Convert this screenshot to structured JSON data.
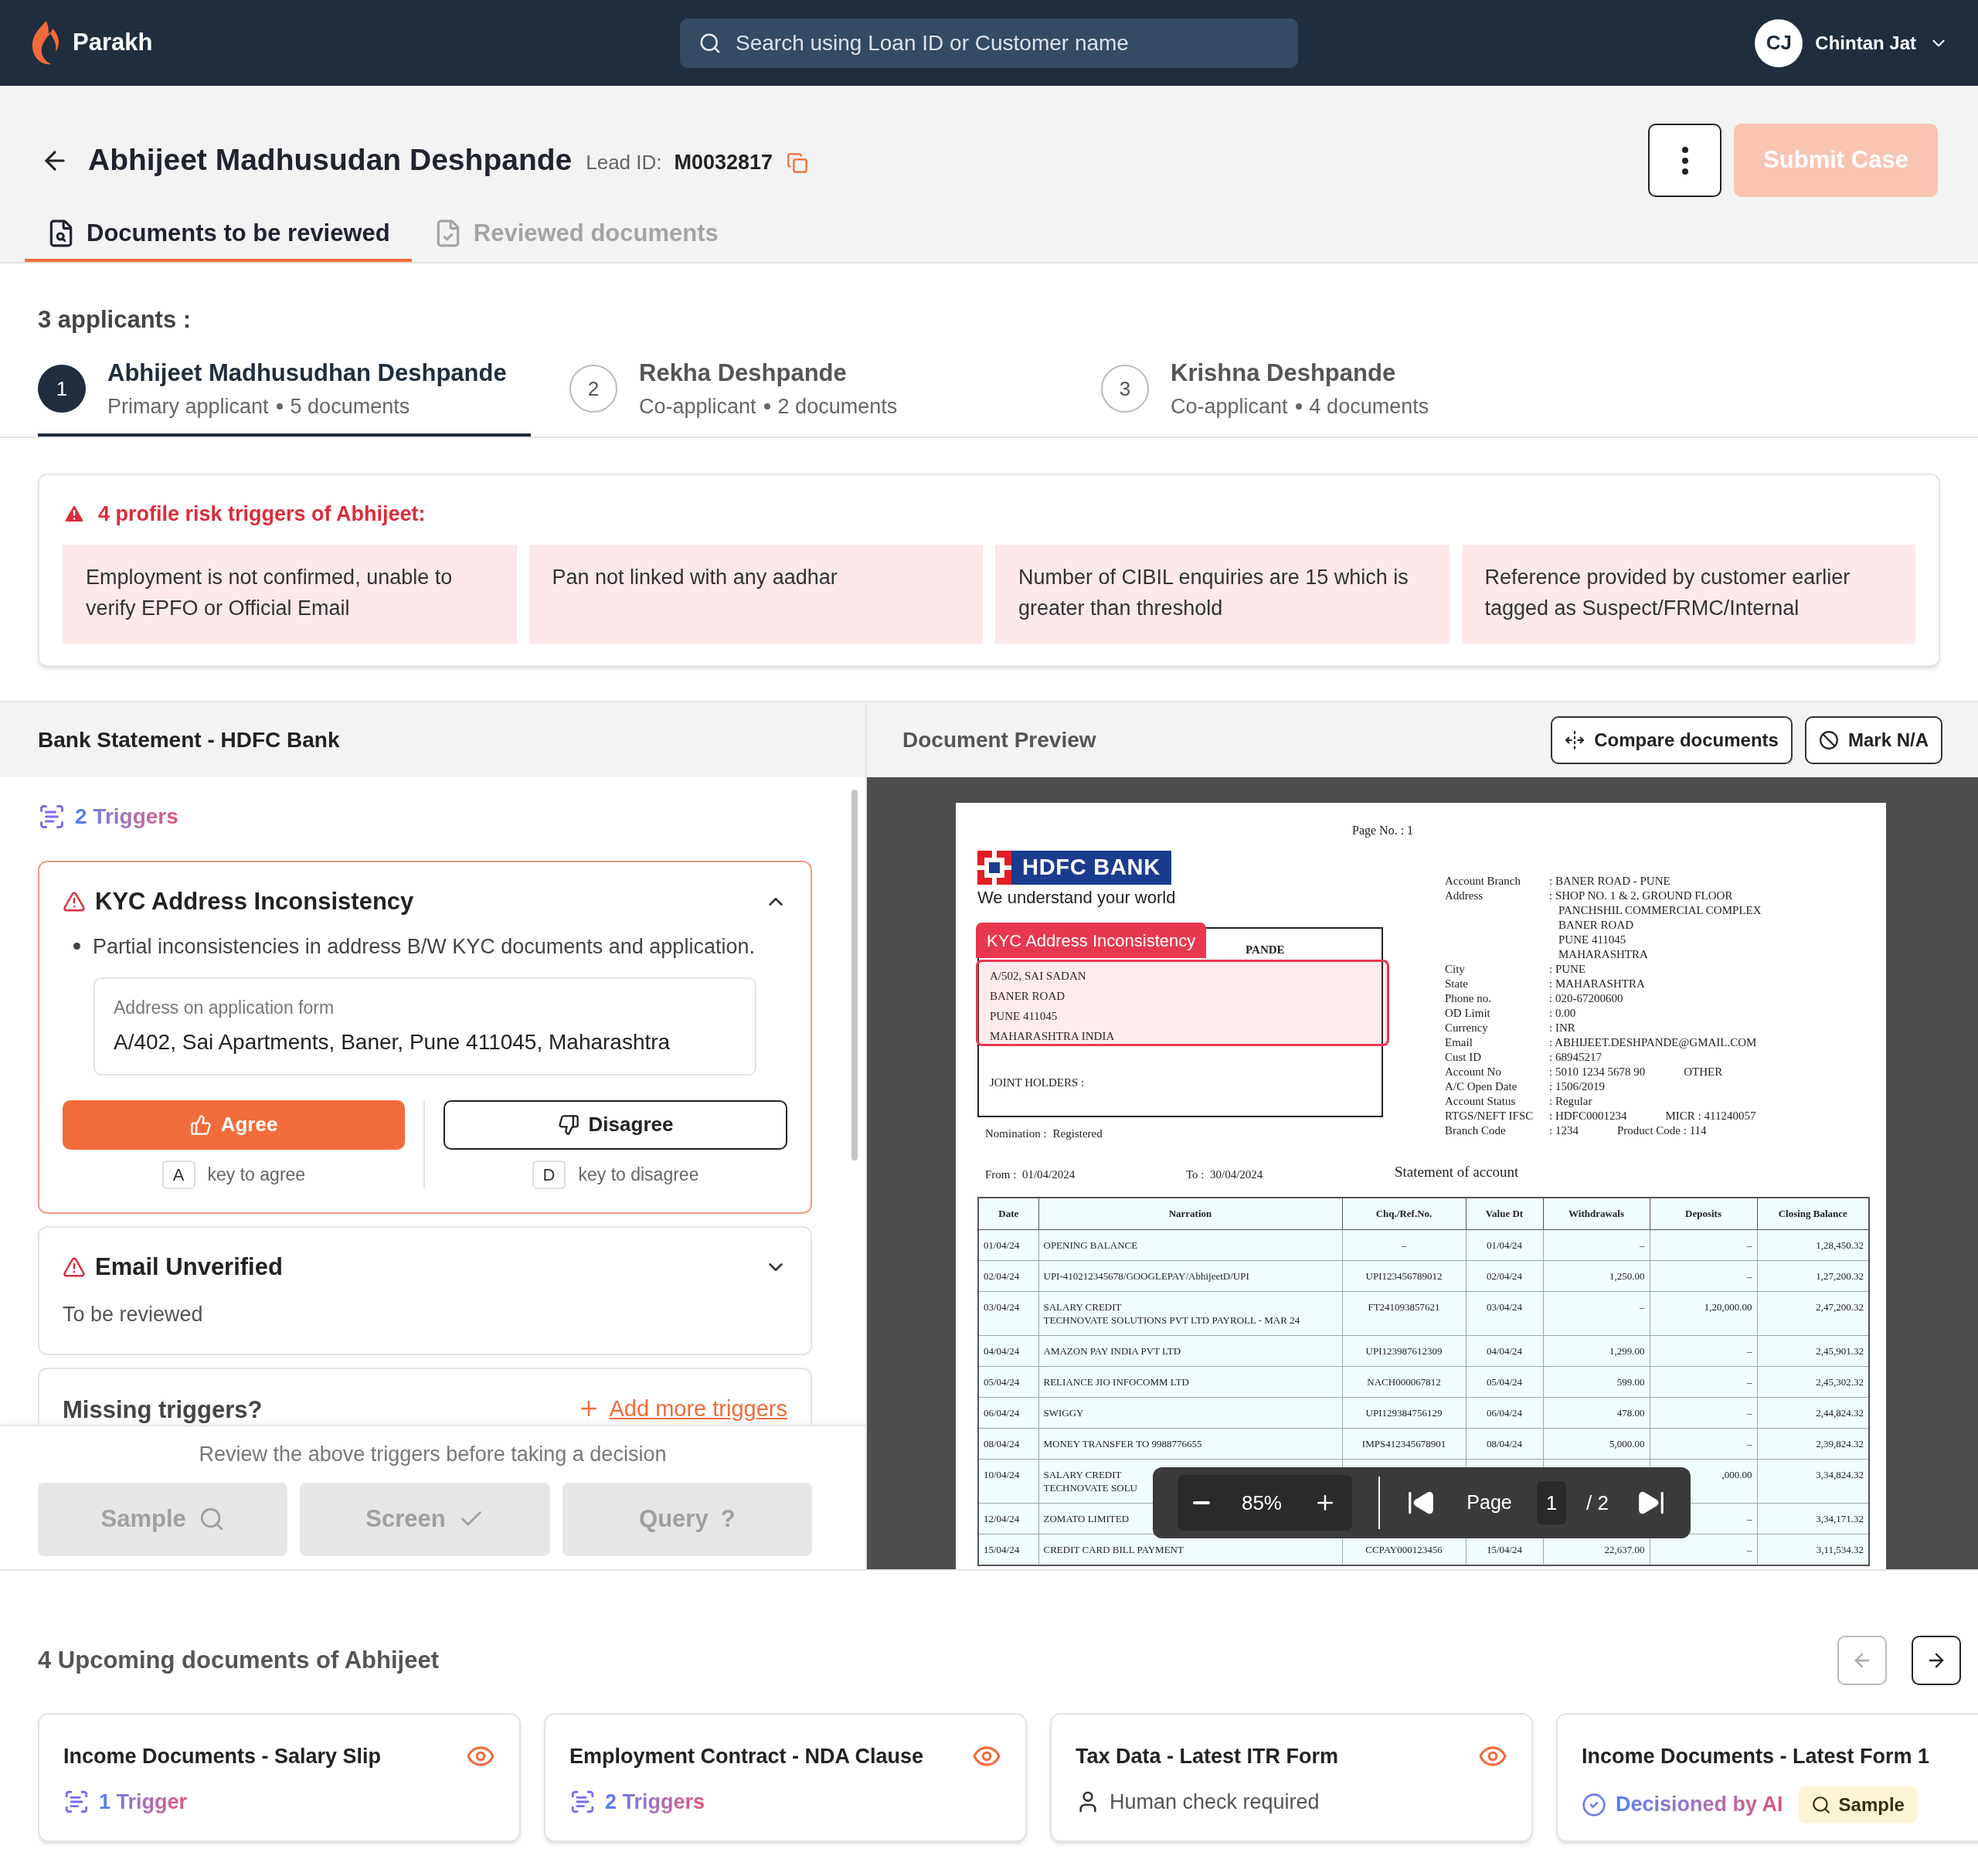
{
  "app": {
    "name": "Parakh",
    "search_placeholder": "Search using Loan ID or Customer name",
    "user": {
      "initials": "CJ",
      "name": "Chintan Jat"
    }
  },
  "header": {
    "title": "Abhijeet Madhusudan Deshpande",
    "lead_label": "Lead ID:",
    "lead_id": "M0032817",
    "submit": {
      "label": "Submit Case",
      "disabled": true
    }
  },
  "tabs": [
    {
      "label": "Documents to be reviewed",
      "selected": true
    },
    {
      "label": "Reviewed documents",
      "selected": false
    }
  ],
  "applicants_heading": "3 applicants :",
  "applicants": [
    {
      "number": "1",
      "name": "Abhijeet Madhusudhan Deshpande",
      "role": "Primary applicant",
      "documents": "5 documents",
      "selected": true
    },
    {
      "number": "2",
      "name": "Rekha Deshpande",
      "role": "Co-applicant",
      "documents": "2 documents",
      "selected": false
    },
    {
      "number": "3",
      "name": "Krishna Deshpande",
      "role": "Co-applicant",
      "documents": "4 documents",
      "selected": false
    }
  ],
  "risk": {
    "title": "4 profile risk triggers of Abhijeet:",
    "triggers": [
      "Employment is not confirmed, unable to verify EPFO or Official Email",
      "Pan not linked with any aadhar",
      "Number of CIBIL enquiries are 15 which is greater than threshold",
      "Reference provided by customer earlier tagged as Suspect/FRMC/Internal"
    ]
  },
  "document": {
    "title": "Bank Statement - HDFC Bank",
    "trigger_count": "2 Triggers",
    "triggers": [
      {
        "title": "KYC Address Inconsistency",
        "expanded": true,
        "bullet": "Partial inconsistencies in address B/W KYC documents and application.",
        "field_label": "Address on application form",
        "field_value": "A/402, Sai Apartments, Baner, Pune 411045, Maharashtra",
        "agree": "Agree",
        "agree_key": "A",
        "agree_hint": "key to agree",
        "disagree": "Disagree",
        "disagree_key": "D",
        "disagree_hint": "key to disagree"
      },
      {
        "title": "Email Unverified",
        "expanded": false,
        "status": "To be reviewed"
      }
    ],
    "missing": "Missing triggers?",
    "add": "Add more triggers",
    "review_note": "Review the above triggers before taking a decision",
    "actions": [
      {
        "label": "Sample",
        "kind": "search",
        "disabled": true
      },
      {
        "label": "Screen",
        "kind": "check",
        "disabled": true
      },
      {
        "label": "Query",
        "kind": "symbol",
        "symbol": "?",
        "disabled": true
      }
    ]
  },
  "preview": {
    "title": "Document Preview",
    "compare": "Compare documents",
    "mark_na": "Mark N/A",
    "statement": {
      "page_no": "Page No. : 1",
      "bank": "HDFC BANK",
      "tagline": "We understand your world",
      "highlight": "KYC Address Inconsistency",
      "name_fragment": "PANDE",
      "address": [
        "A/502, SAI SADAN",
        "BANER ROAD",
        "PUNE 411045",
        "MAHARASHTRA INDIA"
      ],
      "joint_holders": "JOINT HOLDERS :",
      "nomination_label": "Nomination :",
      "nomination": "Registered",
      "details": [
        {
          "label": "Account Branch",
          "value": [
            ": BANER ROAD - PUNE"
          ]
        },
        {
          "label": "Address",
          "value": [
            ": SHOP NO. 1 & 2, GROUND FLOOR",
            "PANCHSHIL COMMERCIAL COMPLEX",
            "BANER ROAD",
            "PUNE 411045",
            "MAHARASHTRA"
          ]
        },
        {
          "label": "City",
          "value": [
            ": PUNE"
          ]
        },
        {
          "label": "State",
          "value": [
            ": MAHARASHTRA"
          ]
        },
        {
          "label": "Phone no.",
          "value": [
            ": 020-67200600"
          ]
        },
        {
          "label": "OD Limit",
          "value": [
            ": 0.00"
          ]
        },
        {
          "label": "Currency",
          "value": [
            ": INR"
          ]
        },
        {
          "label": "Email",
          "value": [
            ": ABHIJEET.DESHPANDE@GMAIL.COM"
          ]
        },
        {
          "label": "Cust ID",
          "value": [
            ": 68945217"
          ]
        },
        {
          "label": "Account No",
          "value": [
            ": 5010 1234 5678 90"
          ],
          "extra": "OTHER"
        },
        {
          "label": "A/C Open Date",
          "value": [
            ": 1506/2019"
          ]
        },
        {
          "label": "Account Status",
          "value": [
            ": Regular"
          ]
        },
        {
          "label": "RTGS/NEFT IFSC",
          "value": [
            ": HDFC0001234"
          ],
          "extra": "MICR : 411240057"
        },
        {
          "label": "Branch Code",
          "value": [
            ": 1234"
          ],
          "extra": "Product Code : 114"
        }
      ],
      "from": "From :  01/04/2024",
      "to": "To :  30/04/2024",
      "statement_title": "Statement of account",
      "columns": [
        "Date",
        "Narration",
        "Chq./Ref.No.",
        "Value Dt",
        "Withdrawals",
        "Deposits",
        "Closing Balance"
      ],
      "rows": [
        {
          "date": "01/04/24",
          "narration": [
            "OPENING BALANCE"
          ],
          "ref": "–",
          "value_date": "01/04/24",
          "withdrawal": "–",
          "deposit": "–",
          "balance": "1,28,450.32"
        },
        {
          "date": "02/04/24",
          "narration": [
            "UPI-410212345678/GOOGLEPAY/AbhijeetD/UPI"
          ],
          "ref": "UPI123456789012",
          "value_date": "02/04/24",
          "withdrawal": "1,250.00",
          "deposit": "–",
          "balance": "1,27,200.32"
        },
        {
          "date": "03/04/24",
          "narration": [
            "SALARY CREDIT",
            "TECHNOVATE SOLUTIONS PVT LTD PAYROLL - MAR 24"
          ],
          "ref": "FT241093857621",
          "value_date": "03/04/24",
          "withdrawal": "–",
          "deposit": "1,20,000.00",
          "balance": "2,47,200.32"
        },
        {
          "date": "04/04/24",
          "narration": [
            "AMAZON PAY INDIA PVT LTD"
          ],
          "ref": "UPI123987612309",
          "value_date": "04/04/24",
          "withdrawal": "1,299.00",
          "deposit": "–",
          "balance": "2,45,901.32"
        },
        {
          "date": "05/04/24",
          "narration": [
            "RELIANCE JIO INFOCOMM LTD"
          ],
          "ref": "NACH000067812",
          "value_date": "05/04/24",
          "withdrawal": "599.00",
          "deposit": "–",
          "balance": "2,45,302.32"
        },
        {
          "date": "06/04/24",
          "narration": [
            "SWIGGY"
          ],
          "ref": "UPI129384756129",
          "value_date": "06/04/24",
          "withdrawal": "478.00",
          "deposit": "–",
          "balance": "2,44,824.32"
        },
        {
          "date": "08/04/24",
          "narration": [
            "MONEY TRANSFER TO 9988776655"
          ],
          "ref": "IMPS412345678901",
          "value_date": "08/04/24",
          "withdrawal": "5,000.00",
          "deposit": "–",
          "balance": "2,39,824.32"
        },
        {
          "date": "10/04/24",
          "narration": [
            "SALARY CREDIT",
            "TECHNOVATE SOLU"
          ],
          "ref": null,
          "value_date": null,
          "withdrawal": null,
          "deposit": ",000.00",
          "balance": "3,34,824.32"
        },
        {
          "date": "12/04/24",
          "narration": [
            "ZOMATO LIMITED"
          ],
          "ref": null,
          "value_date": null,
          "withdrawal": null,
          "deposit": "–",
          "balance": "3,34,171.32"
        },
        {
          "date": "15/04/24",
          "narration": [
            "CREDIT CARD BILL PAYMENT"
          ],
          "ref": "CCPAY000123456",
          "value_date": "15/04/24",
          "withdrawal": "22,637.00",
          "deposit": "–",
          "balance": "3,11,534.32"
        }
      ]
    },
    "toolbar": {
      "zoom": "85%",
      "page_label": "Page",
      "page": "1",
      "total": "/ 2"
    }
  },
  "upcoming": {
    "title": "4 Upcoming documents of Abhijeet",
    "prev_disabled": true,
    "next_disabled": false,
    "cards": [
      {
        "title": "Income Documents - Salary Slip",
        "kind": "triggers",
        "text": "1 Trigger",
        "viewable": true
      },
      {
        "title": "Employment Contract - NDA Clause",
        "kind": "triggers",
        "text": "2 Triggers",
        "viewable": true
      },
      {
        "title": "Tax Data - Latest ITR Form",
        "kind": "human",
        "text": "Human check required",
        "viewable": true
      },
      {
        "title": "Income Documents - Latest Form 1",
        "kind": "ai",
        "text": "Decisioned by AI",
        "badge": "Sample"
      }
    ]
  }
}
